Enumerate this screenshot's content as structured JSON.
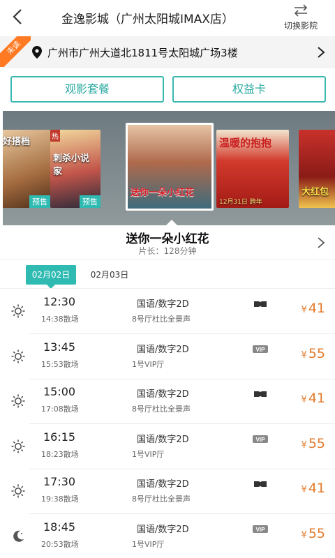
{
  "header": {
    "title": "金逸影城（广州太阳城IMAX店）",
    "switch_label": "切换影院"
  },
  "address": {
    "ribbon": "未读",
    "text": "广州市广州大道北1811号太阳城广场3楼"
  },
  "actions": {
    "package_label": "观影套餐",
    "card_label": "权益卡"
  },
  "carousel": {
    "posters": [
      {
        "title": "好搭档",
        "badge": "预售"
      },
      {
        "title": "刺杀小说家",
        "badge": "预售",
        "hot": "热"
      },
      {
        "title": "送你一朵小红花",
        "badge": ""
      },
      {
        "title": "温暖的抱抱",
        "badge": "",
        "caption": "12月31日 跨年"
      },
      {
        "title": "大红包",
        "badge": ""
      }
    ]
  },
  "movie": {
    "name": "送你一朵小红花",
    "length": "片长：128分钟"
  },
  "dates": {
    "active": "02月02日",
    "other": "02月03日"
  },
  "showtimes": [
    {
      "icon": "sun-icon",
      "start": "12:30",
      "end": "14:38散场",
      "lang": "国语/数字2D",
      "hall": "8号厅杜比全景声",
      "format": "dolby-icon",
      "currency": "¥",
      "price": "41"
    },
    {
      "icon": "sun-icon",
      "start": "13:45",
      "end": "15:53散场",
      "lang": "国语/数字2D",
      "hall": "1号VIP厅",
      "format": "vip-icon",
      "currency": "¥",
      "price": "55"
    },
    {
      "icon": "sun-icon",
      "start": "15:00",
      "end": "17:08散场",
      "lang": "国语/数字2D",
      "hall": "8号厅杜比全景声",
      "format": "dolby-icon",
      "currency": "¥",
      "price": "41"
    },
    {
      "icon": "sun-icon",
      "start": "16:15",
      "end": "18:23散场",
      "lang": "国语/数字2D",
      "hall": "1号VIP厅",
      "format": "vip-icon",
      "currency": "¥",
      "price": "55"
    },
    {
      "icon": "sun-icon",
      "start": "17:30",
      "end": "19:38散场",
      "lang": "国语/数字2D",
      "hall": "8号厅杜比全景声",
      "format": "dolby-icon",
      "currency": "¥",
      "price": "41"
    },
    {
      "icon": "moon-icon",
      "start": "18:45",
      "end": "20:53散场",
      "lang": "国语/数字2D",
      "hall": "1号VIP厅",
      "format": "vip-icon",
      "currency": "¥",
      "price": "55"
    }
  ],
  "colors": {
    "accent": "#2fbab2",
    "price": "#e37b2c",
    "ribbon": "#ff7a22"
  }
}
